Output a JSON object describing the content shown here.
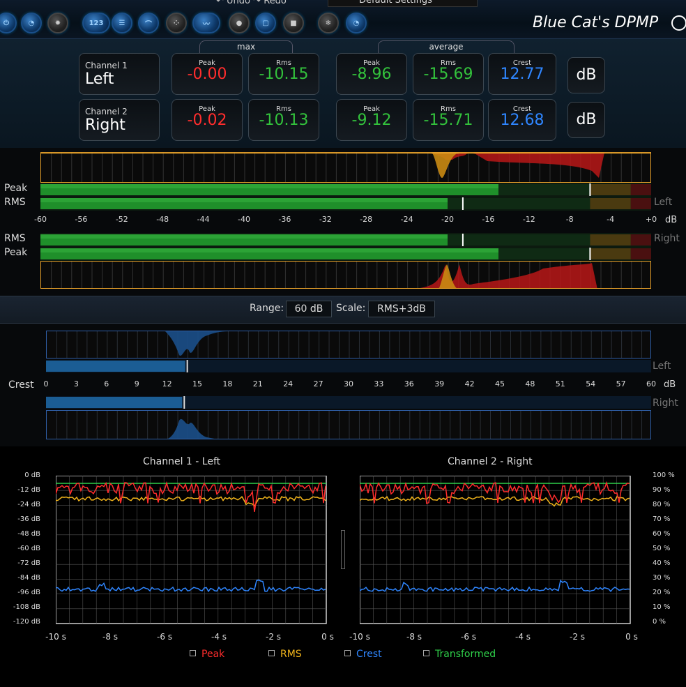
{
  "toolbar": {
    "undo_label": "Undo",
    "redo_label": "Redo",
    "preset_name": "Default Settings",
    "numeric_button": "123",
    "app_title": "Blue Cat's DPMP"
  },
  "readouts": {
    "max_label": "max",
    "average_label": "average",
    "peak_label": "Peak",
    "rms_label": "Rms",
    "crest_label": "Crest",
    "unit": "dB",
    "channels": [
      {
        "line1": "Channel 1",
        "line2": "Left",
        "max_peak": "-0.00",
        "max_rms": "-10.15",
        "avg_peak": "-8.96",
        "avg_rms": "-15.69",
        "crest": "12.77"
      },
      {
        "line1": "Channel 2",
        "line2": "Right",
        "max_peak": "-0.02",
        "max_rms": "-10.13",
        "avg_peak": "-9.12",
        "avg_rms": "-15.71",
        "crest": "12.68"
      }
    ]
  },
  "level_meter": {
    "peak_label": "Peak",
    "rms_label": "RMS",
    "left_label": "Left",
    "right_label": "Right",
    "unit": "dB",
    "ticks": [
      "-60",
      "-56",
      "-52",
      "-48",
      "-44",
      "-40",
      "-36",
      "-32",
      "-28",
      "-24",
      "-20",
      "-16",
      "-12",
      "-8",
      "-4",
      "+0"
    ],
    "min": -60,
    "max": 0,
    "left": {
      "peak": -15.0,
      "rms": -20.0,
      "peak_hold": -6.0,
      "rms_hold": -18.5
    },
    "right": {
      "peak": -15.0,
      "rms": -20.0,
      "peak_hold": -6.0,
      "rms_hold": -18.5
    }
  },
  "range_bar": {
    "range_label": "Range:",
    "range_value": "60 dB",
    "scale_label": "Scale:",
    "scale_value": "RMS+3dB"
  },
  "crest_meter": {
    "label": "Crest",
    "left_label": "Left",
    "right_label": "Right",
    "unit": "dB",
    "ticks": [
      "0",
      "3",
      "6",
      "9",
      "12",
      "15",
      "18",
      "21",
      "24",
      "27",
      "30",
      "33",
      "36",
      "39",
      "42",
      "45",
      "48",
      "51",
      "54",
      "57",
      "60"
    ],
    "min": 0,
    "max": 60,
    "left_value": 13.8,
    "right_value": 13.5
  },
  "history": {
    "left_title": "Channel 1 - Left",
    "right_title": "Channel 2 - Right",
    "y_db_labels": [
      "0 dB",
      "-12 dB",
      "-24 dB",
      "-36 dB",
      "-48 dB",
      "-60 dB",
      "-72 dB",
      "-84 dB",
      "-96 dB",
      "-108 dB",
      "-120 dB"
    ],
    "y_pct_labels": [
      "100 %",
      "90 %",
      "80 %",
      "70 %",
      "60 %",
      "50 %",
      "40 %",
      "30 %",
      "20 %",
      "10 %",
      "0 %"
    ],
    "x_labels": [
      "-10 s",
      "-8 s",
      "-6 s",
      "-4 s",
      "-2 s",
      "0 s"
    ],
    "legend": [
      {
        "label": "Peak",
        "color": "#ff2d2d"
      },
      {
        "label": "RMS",
        "color": "#f2b51b"
      },
      {
        "label": "Crest",
        "color": "#2f86ff"
      },
      {
        "label": "Transformed",
        "color": "#2fd14a"
      }
    ]
  },
  "colors": {
    "peak": "#ff2d2d",
    "rms": "#f2b51b",
    "crest": "#2f86ff",
    "transformed": "#2fd14a",
    "meter_green": "#1f8f2a"
  }
}
